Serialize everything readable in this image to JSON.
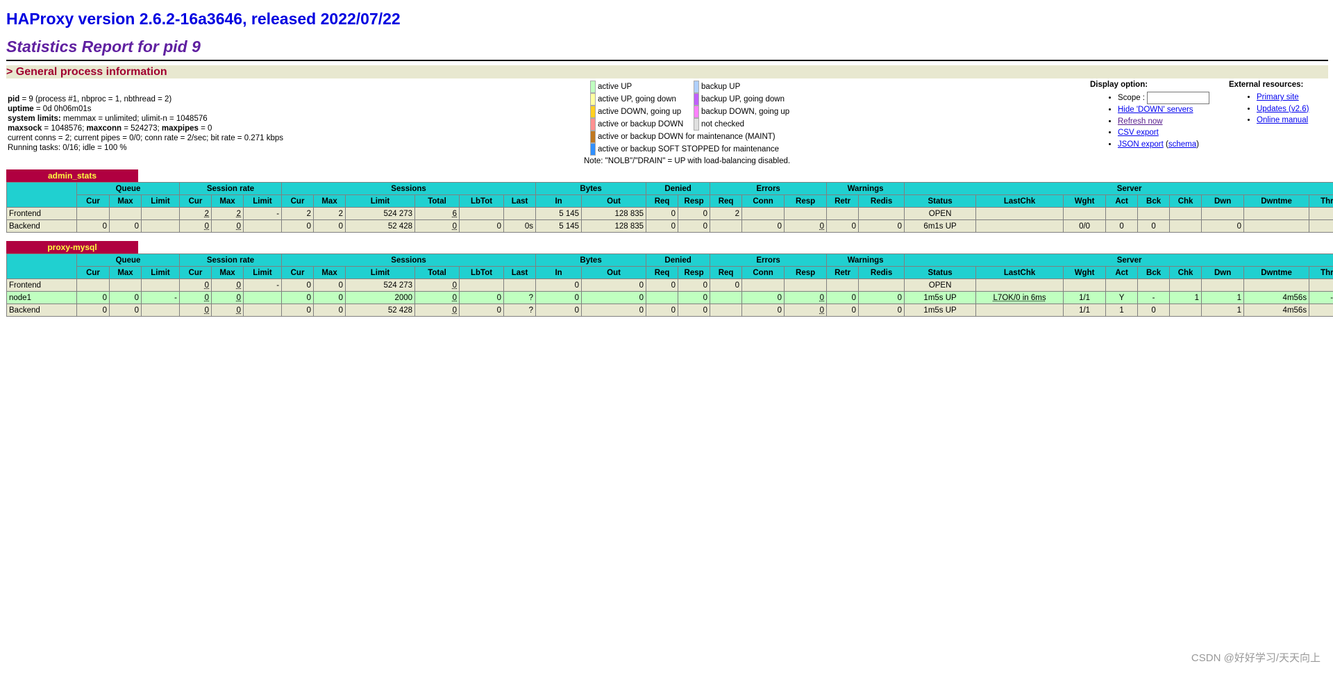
{
  "header": {
    "title": "HAProxy version 2.6.2-16a3646, released 2022/07/22",
    "subtitle": "Statistics Report for pid 9",
    "section": "> General process information"
  },
  "process_info": {
    "line1_label": "pid",
    "line1_value": " = 9 (process #1, nbproc = 1, nbthread = 2)",
    "line2_label": "uptime",
    "line2_value": " = 0d 0h06m01s",
    "line3_label": "system limits:",
    "line3_value": " memmax = unlimited; ulimit-n = 1048576",
    "line4_label_a": "maxsock",
    "line4_value_a": " = 1048576; ",
    "line4_label_b": "maxconn",
    "line4_value_b": " = 524273; ",
    "line4_label_c": "maxpipes",
    "line4_value_c": " = 0",
    "line5": "current conns = 2; current pipes = 0/0; conn rate = 2/sec; bit rate = 0.271 kbps",
    "line6": "Running tasks: 0/16; idle = 100 %"
  },
  "legend": {
    "col1": [
      {
        "label": "active UP",
        "color": "#c0ffc0"
      },
      {
        "label": "active UP, going down",
        "color": "#ffffa0"
      },
      {
        "label": "active DOWN, going up",
        "color": "#ffd020"
      },
      {
        "label": "active or backup DOWN",
        "color": "#ff9090"
      },
      {
        "label": "active or backup DOWN for maintenance (MAINT)",
        "color": "#c07820"
      },
      {
        "label": "active or backup SOFT STOPPED for maintenance",
        "color": "#3090ff"
      }
    ],
    "col2": [
      {
        "label": "backup UP",
        "color": "#b0d0ff"
      },
      {
        "label": "backup UP, going down",
        "color": "#c060ff"
      },
      {
        "label": "backup DOWN, going up",
        "color": "#ff80ff"
      },
      {
        "label": "not checked",
        "color": "#e0e0e0"
      }
    ],
    "note": "Note: \"NOLB\"/\"DRAIN\" = UP with load-balancing disabled."
  },
  "display_options": {
    "heading": "Display option:",
    "scope_label": "Scope :",
    "scope_value": "",
    "links": [
      "Hide 'DOWN' servers",
      "Refresh now",
      "CSV export"
    ],
    "json_export": "JSON export",
    "schema": "schema"
  },
  "external": {
    "heading": "External resources:",
    "links": [
      "Primary site",
      "Updates (v2.6)",
      "Online manual"
    ]
  },
  "table_headers": {
    "groups1": [
      "Queue",
      "Session rate",
      "Sessions",
      "Bytes",
      "Denied",
      "Errors",
      "Warnings",
      "Server"
    ],
    "sub": [
      "Cur",
      "Max",
      "Limit",
      "Cur",
      "Max",
      "Limit",
      "Cur",
      "Max",
      "Limit",
      "Total",
      "LbTot",
      "Last",
      "In",
      "Out",
      "Req",
      "Resp",
      "Req",
      "Conn",
      "Resp",
      "Retr",
      "Redis",
      "Status",
      "LastChk",
      "Wght",
      "Act",
      "Bck",
      "Chk",
      "Dwn",
      "Dwntme",
      "Thrtle"
    ]
  },
  "proxies": [
    {
      "name": "admin_stats",
      "rows": [
        {
          "kind": "frontend",
          "cells": [
            "Frontend",
            "",
            "",
            "",
            "2",
            "2",
            "-",
            "2",
            "2",
            "524 273",
            "6",
            "",
            "",
            "5 145",
            "128 835",
            "0",
            "0",
            "2",
            "",
            "",
            "",
            "",
            "OPEN",
            "",
            "",
            "",
            "",
            "",
            "",
            "",
            ""
          ]
        },
        {
          "kind": "backend",
          "cells": [
            "Backend",
            "0",
            "0",
            "",
            "0",
            "0",
            "",
            "0",
            "0",
            "52 428",
            "0",
            "0",
            "0s",
            "5 145",
            "128 835",
            "0",
            "0",
            "",
            "0",
            "0",
            "0",
            "0",
            "6m1s UP",
            "",
            "0/0",
            "0",
            "0",
            "",
            "0",
            "",
            ""
          ]
        }
      ]
    },
    {
      "name": "proxy-mysql",
      "rows": [
        {
          "kind": "frontend",
          "cells": [
            "Frontend",
            "",
            "",
            "",
            "0",
            "0",
            "-",
            "0",
            "0",
            "524 273",
            "0",
            "",
            "",
            "0",
            "0",
            "0",
            "0",
            "0",
            "",
            "",
            "",
            "",
            "OPEN",
            "",
            "",
            "",
            "",
            "",
            "",
            "",
            ""
          ]
        },
        {
          "kind": "up",
          "cells": [
            "node1",
            "0",
            "0",
            "-",
            "0",
            "0",
            "",
            "0",
            "0",
            "2000",
            "0",
            "0",
            "?",
            "0",
            "0",
            "",
            "0",
            "",
            "0",
            "0",
            "0",
            "0",
            "1m5s UP",
            "L7OK/0 in 6ms",
            "1/1",
            "Y",
            "-",
            "1",
            "1",
            "4m56s",
            "-"
          ]
        },
        {
          "kind": "backend",
          "cells": [
            "Backend",
            "0",
            "0",
            "",
            "0",
            "0",
            "",
            "0",
            "0",
            "52 428",
            "0",
            "0",
            "?",
            "0",
            "0",
            "0",
            "0",
            "",
            "0",
            "0",
            "0",
            "0",
            "1m5s UP",
            "",
            "1/1",
            "1",
            "0",
            "",
            "1",
            "4m56s",
            ""
          ]
        }
      ]
    }
  ],
  "watermark": "CSDN @好好学习/天天向上"
}
